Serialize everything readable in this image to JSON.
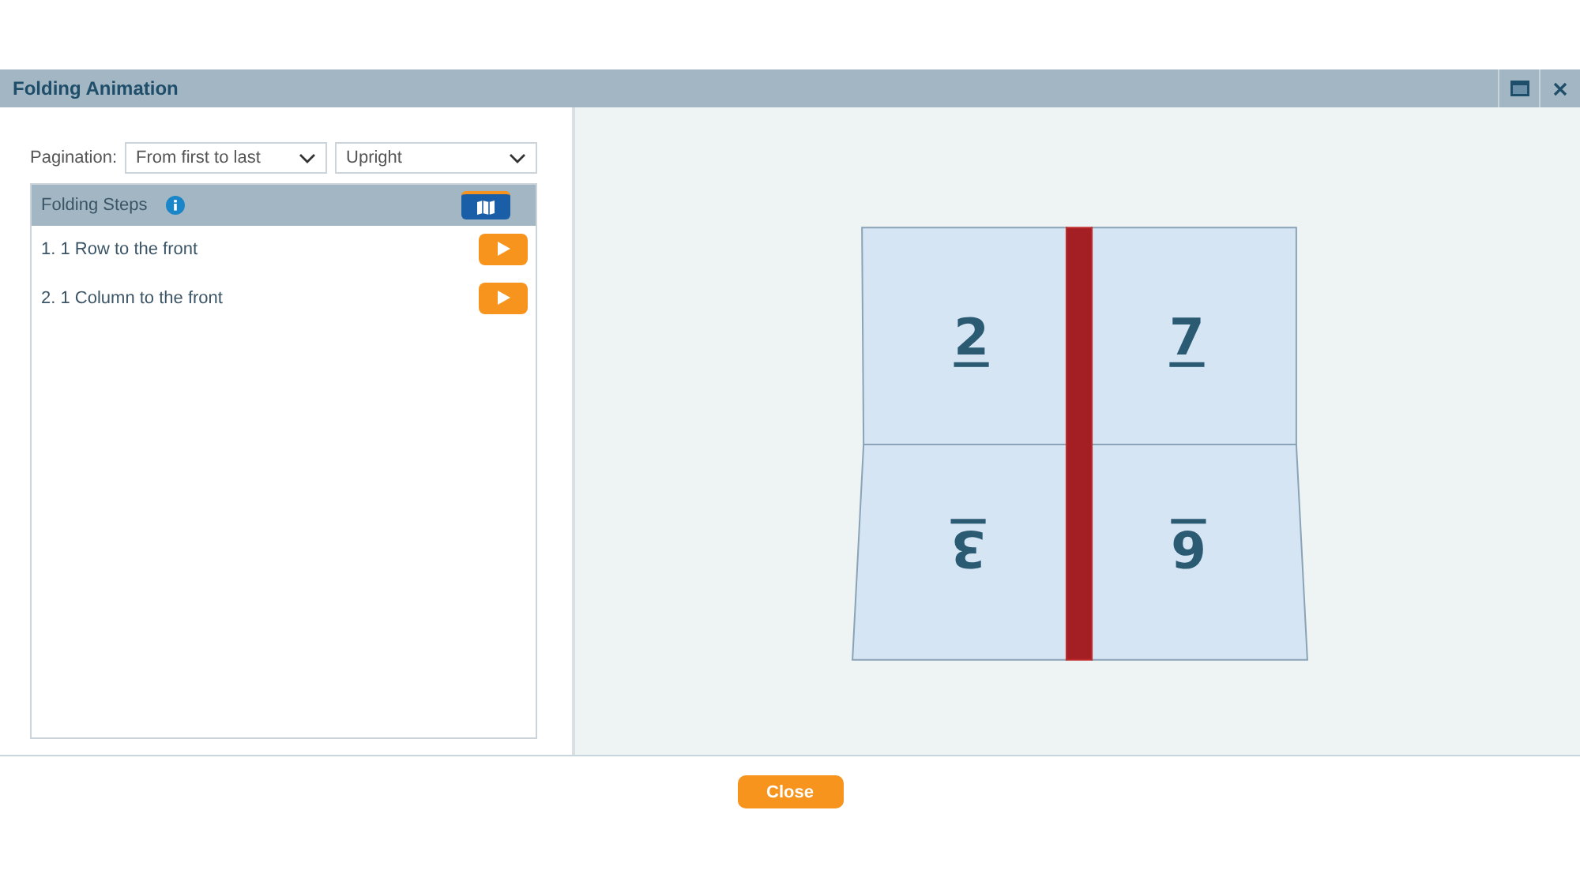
{
  "window": {
    "title": "Folding Animation"
  },
  "pagination": {
    "label": "Pagination:",
    "order": "From first to last",
    "orientation": "Upright"
  },
  "steps_panel": {
    "title": "Folding Steps",
    "steps": [
      {
        "label": "1. 1 Row to the front"
      },
      {
        "label": "2. 1 Column to the front"
      }
    ]
  },
  "sheet": {
    "pages": [
      {
        "number": "2",
        "upside_down": false
      },
      {
        "number": "7",
        "upside_down": false
      },
      {
        "number": "3",
        "upside_down": true
      },
      {
        "number": "6",
        "upside_down": true
      }
    ]
  },
  "buttons": [
    "Close"
  ]
}
